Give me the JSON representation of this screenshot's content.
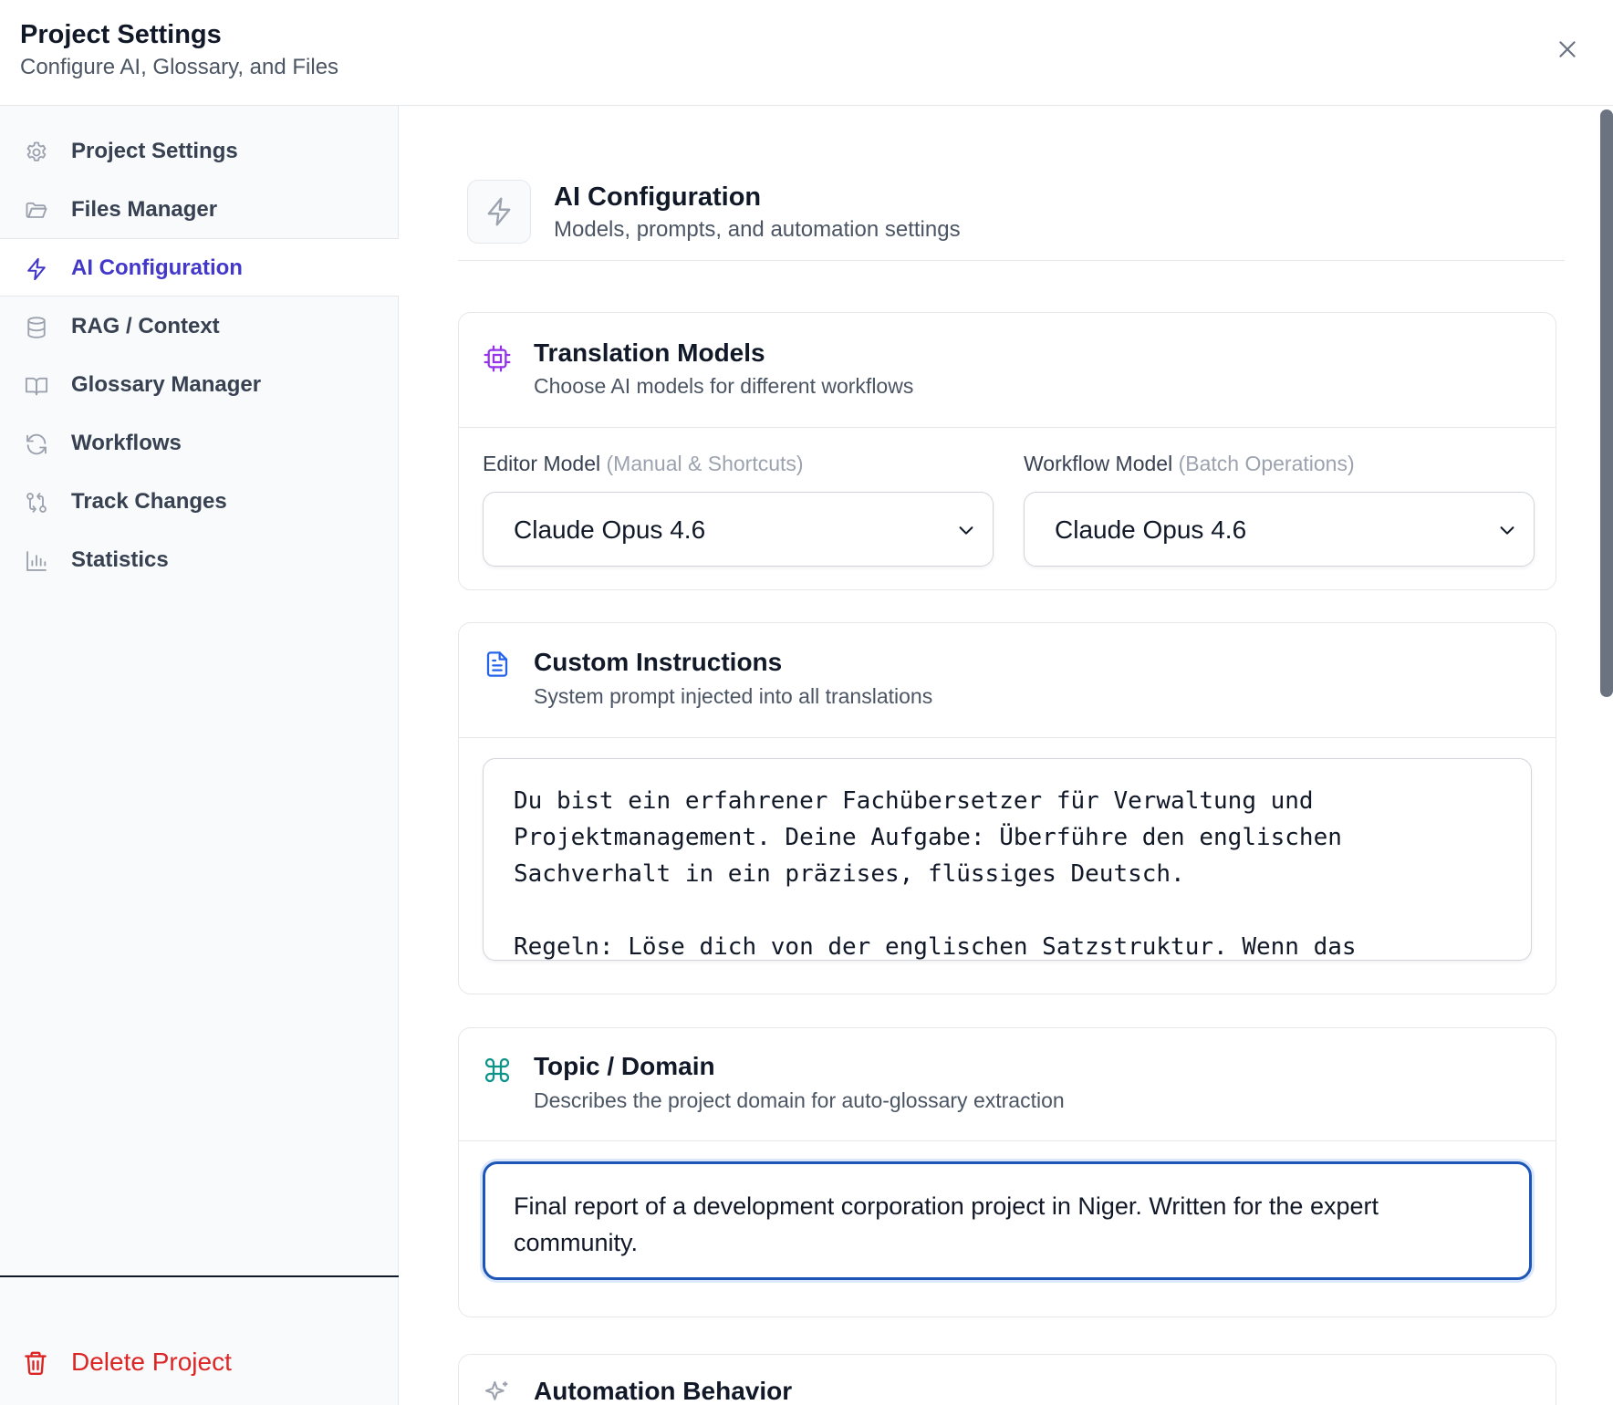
{
  "header": {
    "title": "Project Settings",
    "subtitle": "Configure AI, Glossary, and Files",
    "close_icon": "close-icon"
  },
  "sidebar": {
    "items": [
      {
        "label": "Project Settings",
        "icon": "gear-icon",
        "active": false
      },
      {
        "label": "Files Manager",
        "icon": "folder-icon",
        "active": false
      },
      {
        "label": "AI Configuration",
        "icon": "lightning-icon",
        "active": true
      },
      {
        "label": "RAG / Context",
        "icon": "database-icon",
        "active": false
      },
      {
        "label": "Glossary Manager",
        "icon": "book-icon",
        "active": false
      },
      {
        "label": "Workflows",
        "icon": "refresh-icon",
        "active": false
      },
      {
        "label": "Track Changes",
        "icon": "git-compare-icon",
        "active": false
      },
      {
        "label": "Statistics",
        "icon": "bar-chart-icon",
        "active": false
      }
    ],
    "delete_label": "Delete Project",
    "delete_icon": "trash-icon"
  },
  "section": {
    "title": "AI Configuration",
    "subtitle": "Models, prompts, and automation settings",
    "icon": "lightning-icon"
  },
  "translation_models": {
    "title": "Translation Models",
    "subtitle": "Choose AI models for different workflows",
    "icon": "cpu-icon",
    "editor_label": "Editor Model",
    "editor_hint": "(Manual & Shortcuts)",
    "editor_value": "Claude Opus 4.6",
    "workflow_label": "Workflow Model",
    "workflow_hint": "(Batch Operations)",
    "workflow_value": "Claude Opus 4.6"
  },
  "custom_instructions": {
    "title": "Custom Instructions",
    "subtitle": "System prompt injected into all translations",
    "icon": "document-icon",
    "value": "Du bist ein erfahrener Fachübersetzer für Verwaltung und Projektmanagement. Deine Aufgabe: Überführe den englischen Sachverhalt in ein präzises, flüssiges Deutsch.\n\nRegeln: Löse dich von der englischen Satzstruktur. Wenn das"
  },
  "topic_domain": {
    "title": "Topic / Domain",
    "subtitle": "Describes the project domain for auto-glossary extraction",
    "icon": "command-icon",
    "value": "Final report of a development corporation project in Niger. Written for the expert community."
  },
  "automation": {
    "title": "Automation Behavior",
    "icon": "sparkles-icon"
  },
  "colors": {
    "accent": "#4338ca",
    "danger": "#dc2626",
    "focus": "#1e56b8",
    "cpu_icon": "#9333ea",
    "doc_icon": "#2563eb",
    "command_icon": "#0d9488"
  }
}
